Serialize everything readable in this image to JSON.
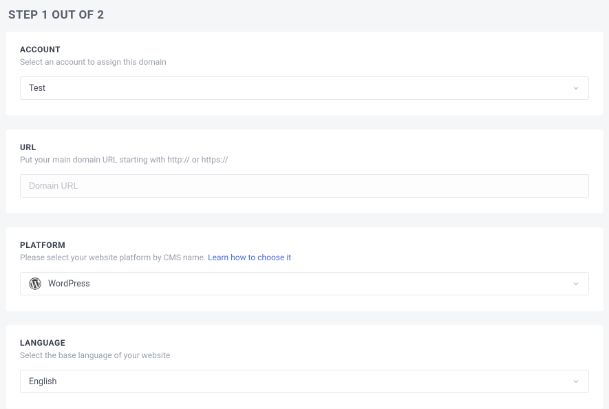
{
  "page_title": "STEP 1 OUT OF 2",
  "sections": {
    "account": {
      "title": "ACCOUNT",
      "desc": "Select an account to assign this domain",
      "value": "Test"
    },
    "url": {
      "title": "URL",
      "desc": "Put your main domain URL starting with http:// or https://",
      "placeholder": "Domain URL"
    },
    "platform": {
      "title": "PLATFORM",
      "desc_prefix": "Please select your website platform by CMS name.  ",
      "link_text": "Learn how to choose it",
      "value": "WordPress"
    },
    "language": {
      "title": "LANGUAGE",
      "desc": "Select the base language of your website",
      "value": "English"
    }
  }
}
